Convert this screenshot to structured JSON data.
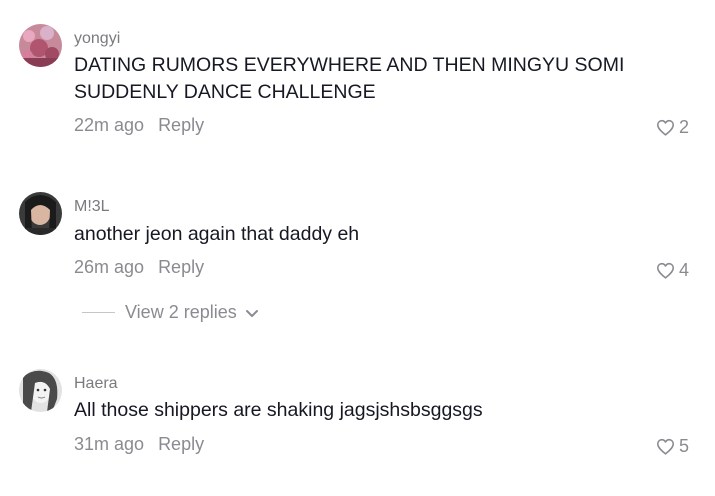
{
  "comments": [
    {
      "username": "yongyi",
      "text": "DATING RUMORS EVERYWHERE AND THEN MINGYU SOMI SUDDENLY DANCE CHALLENGE",
      "time": "22m ago",
      "reply_label": "Reply",
      "likes": "2"
    },
    {
      "username": "M!3L",
      "text": "another jeon again that daddy eh",
      "time": "26m ago",
      "reply_label": "Reply",
      "likes": "4",
      "view_replies_label": "View 2 replies"
    },
    {
      "username": "Haera",
      "text": "All those shippers are shaking jagsjshsbsggsgs",
      "time": "31m ago",
      "reply_label": "Reply",
      "likes": "5"
    }
  ],
  "icons": {
    "like": "heart-outline-icon",
    "expand": "chevron-down-icon"
  },
  "colors": {
    "text": "#161823",
    "secondary": "#8a8b91",
    "username": "#7a7a7f"
  }
}
